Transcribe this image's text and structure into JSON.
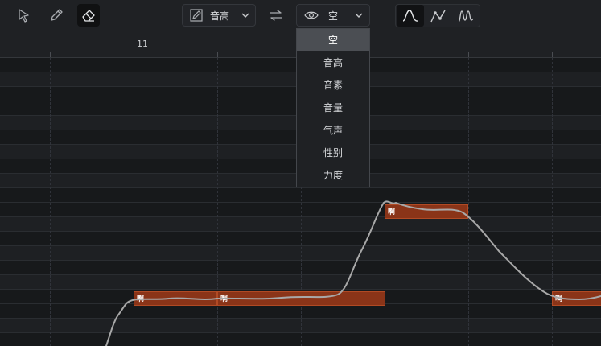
{
  "toolbar": {
    "param_select": {
      "value": "音高"
    },
    "view_select": {
      "value": "空"
    },
    "tools": [
      "pointer-icon",
      "pencil-icon",
      "eraser-icon"
    ],
    "swap_icon": "swap-arrows-icon",
    "view_modes": [
      "curve-smooth-icon",
      "curve-anchor-icon",
      "curve-vibrato-icon"
    ]
  },
  "ruler": {
    "bar_number": "11"
  },
  "dropdown": {
    "items": [
      "空",
      "音高",
      "音素",
      "音量",
      "气声",
      "性别",
      "力度"
    ],
    "selected_index": 0
  },
  "notes": [
    {
      "lyric": "啊"
    },
    {
      "lyric": "啊"
    },
    {
      "lyric": "啊"
    },
    {
      "lyric": "啊"
    }
  ],
  "colors": {
    "note_fill": "#8a3418",
    "note_border": "#b14a24",
    "pitch_curve": "#a8a8a8",
    "dropdown_selected": "#4b4e53"
  }
}
